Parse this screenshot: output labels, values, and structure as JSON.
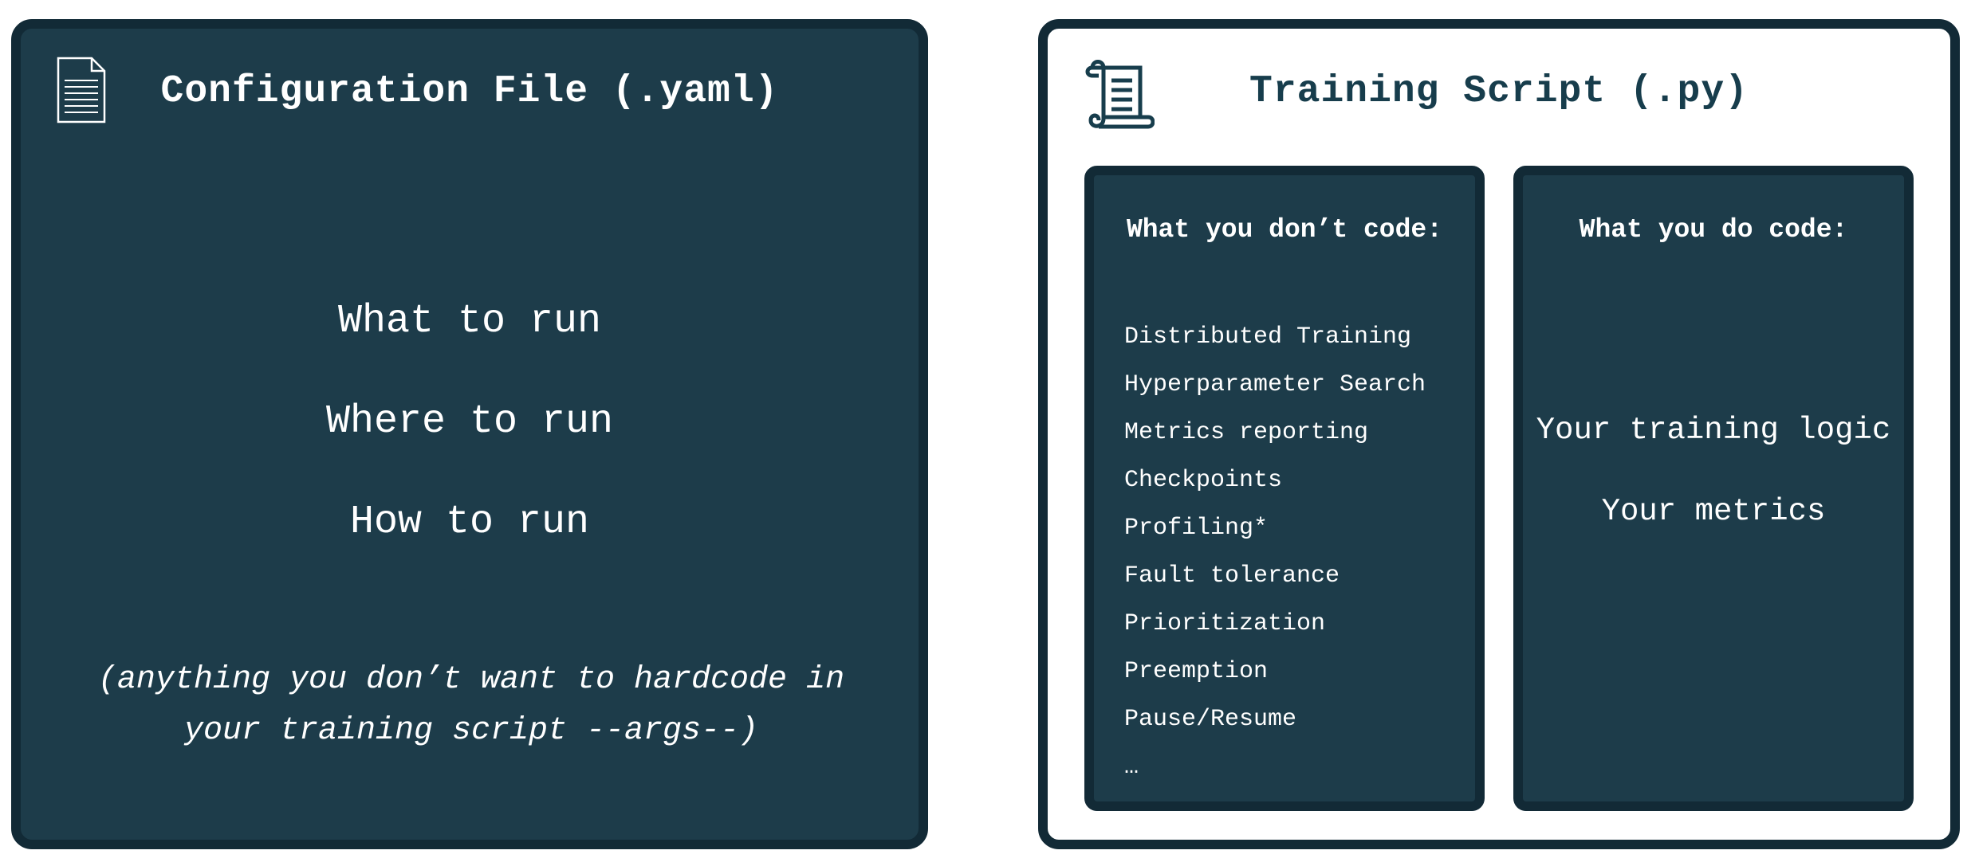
{
  "config_panel": {
    "title": "Configuration File (.yaml)",
    "icon": "document-icon",
    "items": [
      "What to run",
      "Where to run",
      "How to run"
    ],
    "note": "(anything you don’t want to hardcode in your training script --args--)"
  },
  "script_panel": {
    "title": "Training Script (.py)",
    "icon": "scroll-icon",
    "dont_code": {
      "heading": "What you don’t code:",
      "items": [
        "Distributed Training",
        "Hyperparameter Search",
        "Metrics reporting",
        "Checkpoints",
        "Profiling*",
        "Fault tolerance",
        "Prioritization",
        "Preemption",
        "Pause/Resume",
        "…"
      ]
    },
    "do_code": {
      "heading": "What you do code:",
      "items": [
        "Your training logic",
        "Your metrics"
      ]
    }
  },
  "colors": {
    "panel_fill": "#1d3c4a",
    "panel_border": "#122a36",
    "title_dark": "#173d4c",
    "text_light": "#ffffff"
  }
}
